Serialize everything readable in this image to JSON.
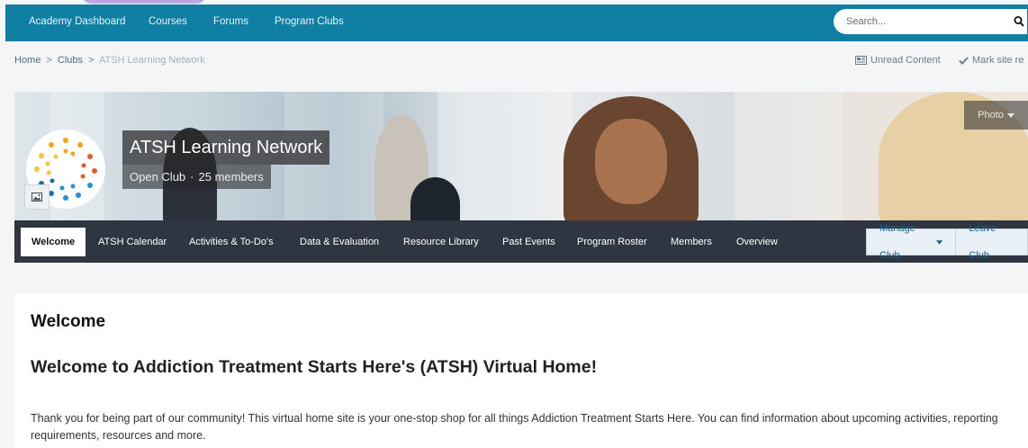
{
  "nav": {
    "items": [
      {
        "label": "Academy Dashboard"
      },
      {
        "label": "Courses"
      },
      {
        "label": "Forums"
      },
      {
        "label": "Program Clubs"
      }
    ],
    "search": {
      "placeholder": "Search..."
    }
  },
  "breadcrumb": {
    "items": [
      "Home",
      "Clubs"
    ],
    "current": "ATSH Learning Network",
    "separator": ">"
  },
  "quick_links": {
    "unread": "Unread Content",
    "mark_read": "Mark site re"
  },
  "club": {
    "title": "ATSH Learning Network",
    "type": "Open Club",
    "separator": "·",
    "members": "25 members",
    "photo_button": "Photo"
  },
  "tabs": [
    {
      "label": "Welcome",
      "active": true
    },
    {
      "label": "ATSH Calendar"
    },
    {
      "label": "Activities & To-Do's"
    },
    {
      "label": "Data & Evaluation"
    },
    {
      "label": "Resource Library"
    },
    {
      "label": "Past Events"
    },
    {
      "label": "Program Roster"
    },
    {
      "label": "Members"
    },
    {
      "label": "Overview"
    }
  ],
  "tab_actions": {
    "manage": "Manage Club",
    "leave": "Leave Club"
  },
  "content": {
    "heading": "Welcome",
    "title": "Welcome to Addiction Treatment Starts Here's (ATSH) Virtual Home!",
    "body": "Thank you for being part of our community! This virtual home site is your one-stop shop for all things Addiction Treatment Starts Here. You can find information about upcoming activities, reporting requirements, resources and more."
  },
  "colors": {
    "navbar": "#0f7fa3",
    "tabbar": "#2f3641",
    "link": "#1b5f8a"
  }
}
